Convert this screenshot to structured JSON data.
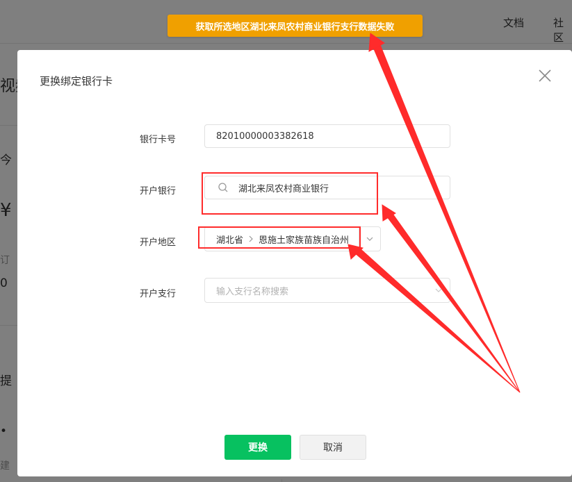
{
  "background": {
    "nav": [
      "文档",
      "社区"
    ],
    "side_fragments": [
      "视频",
      "今",
      "¥",
      "订",
      "0",
      "提",
      "•",
      "建"
    ]
  },
  "toast": {
    "text": "获取所选地区湖北来凤农村商业银行支行数据失败"
  },
  "dialog": {
    "title": "更换绑定银行卡",
    "fields": {
      "card_number_label": "银行卡号",
      "card_number_value": "82010000003382618",
      "bank_label": "开户银行",
      "bank_value": "湖北来凤农村商业银行",
      "region_label": "开户地区",
      "region_province": "湖北省",
      "region_prefecture": "恩施土家族苗族自治州",
      "branch_label": "开户支行",
      "branch_placeholder": "输入支行名称搜索"
    },
    "buttons": {
      "confirm": "更换",
      "cancel": "取消"
    }
  },
  "colors": {
    "toast_bg": "#f0a000",
    "primary": "#07c160",
    "annotation_red": "#ff2b2b"
  },
  "icons": {
    "close": "close-icon",
    "search": "search-icon",
    "separator": "chevron-right-icon",
    "dropdown": "chevron-down-icon"
  }
}
